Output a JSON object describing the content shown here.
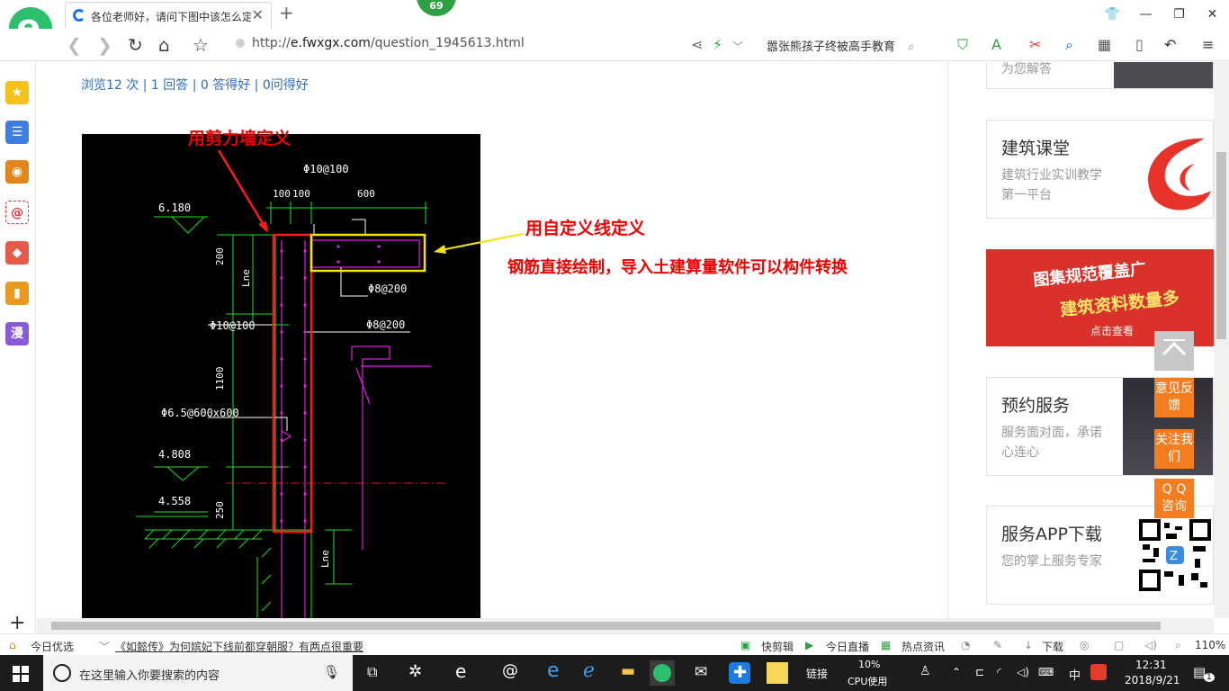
{
  "browser": {
    "tab_title": "各位老师好，请问下图中该怎么定义",
    "badge": "69",
    "url_prefix": "http://",
    "url_host": "e.fwxgx.com",
    "url_path": "/question_1945613.html",
    "search_text": "嚣张熊孩子终被高手教育",
    "icons": [
      "back-icon",
      "forward-icon",
      "refresh-icon",
      "home-icon",
      "star-icon",
      "share-icon",
      "lightning-icon"
    ]
  },
  "sidebar": {
    "items": [
      {
        "icon": "favorites-icon",
        "color": "#f5c21b",
        "glyph": "★"
      },
      {
        "icon": "news-list-icon",
        "color": "#3d7ee0",
        "glyph": "☰"
      },
      {
        "icon": "weibo-icon",
        "color": "#e0861b",
        "glyph": "◉"
      },
      {
        "icon": "mail-icon",
        "color": "#e8e8e8",
        "glyph": "@"
      },
      {
        "icon": "game-icon",
        "color": "#e55b4b",
        "glyph": "◆"
      },
      {
        "icon": "book-icon",
        "color": "#e79a1d",
        "glyph": "▮"
      },
      {
        "icon": "comic-icon",
        "color": "#8a5bd6",
        "glyph": "漫"
      }
    ],
    "plus": "+"
  },
  "page": {
    "stats": "浏览12 次 | 1 回答 | 0 答得好 | 0问得好",
    "annotations": {
      "shear_wall": "用剪力墙定义",
      "custom_line": "用自定义线定义",
      "rebar_note": "钢筋直接绘制，导入土建算量软件可以构件转换"
    },
    "cad": {
      "labels": [
        "6.180",
        "Φ10@100",
        "100",
        "100",
        "600",
        "200",
        "Lne",
        "Φ8@200",
        "Φ10@100",
        "Φ8@200",
        "1100",
        "Φ6.5@600x600",
        "4.808",
        "4.558",
        "250",
        "Lne"
      ]
    }
  },
  "right_panel": {
    "partial_card_text": "为您解答",
    "card_course": {
      "title": "建筑课堂",
      "desc": "建筑行业实训教学第一平台"
    },
    "banner": {
      "line1": "图集规范覆盖广",
      "line2": "建筑资料数量多",
      "link": "点击查看"
    },
    "card_service": {
      "title": "预约服务",
      "desc": "服务面对面，承诺心连心"
    },
    "card_app": {
      "title": "服务APP下载",
      "desc": "您的掌上服务专家"
    },
    "float_buttons": [
      "意见反馈",
      "关注我们",
      "Q Q 咨询"
    ]
  },
  "newsbar": {
    "left_label": "今日优选",
    "headline": "《如懿传》为何嫔妃下线前都穿朝服？有两点很重要",
    "items": [
      "快剪辑",
      "今日直播",
      "热点资讯",
      "下载"
    ],
    "zoom": "110%"
  },
  "taskbar": {
    "search_placeholder": "在这里输入你要搜索的内容",
    "link_label": "链接",
    "cpu_percent": "10%",
    "cpu_label": "CPU使用",
    "ime": "中",
    "time": "12:31",
    "date": "2018/9/21",
    "notification_count": "1"
  }
}
